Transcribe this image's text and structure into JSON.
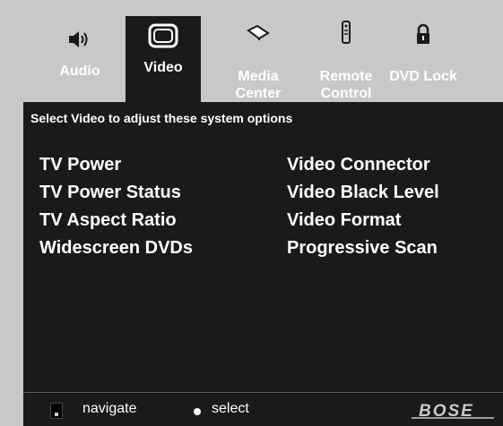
{
  "tabs": [
    {
      "id": "audio",
      "label": "Audio",
      "icon": "speaker-icon",
      "selected": false
    },
    {
      "id": "video",
      "label": "Video",
      "icon": "tv-icon",
      "selected": true
    },
    {
      "id": "media",
      "label": "Media Center",
      "icon": "media-center-icon",
      "selected": false
    },
    {
      "id": "remote",
      "label": "Remote Control",
      "icon": "remote-control-icon",
      "selected": false
    },
    {
      "id": "dvd",
      "label": "DVD Lock",
      "icon": "lock-icon",
      "selected": false
    }
  ],
  "panel": {
    "subtitle": "Select Video to adjust these system options",
    "left_options": [
      "TV Power",
      "TV Power Status",
      "TV Aspect Ratio",
      "Widescreen DVDs"
    ],
    "right_options": [
      "Video Connector",
      "Video Black Level",
      "Video Format",
      "Progressive Scan"
    ]
  },
  "footer": {
    "navigate_label": "navigate",
    "select_label": "select",
    "navigate_icon": "navigate-icon",
    "select_icon": "select-dot-icon",
    "logo_text": "BOSE"
  },
  "colors": {
    "background": "#c8c8c8",
    "panel": "#1b1919",
    "text": "#ffffff"
  }
}
